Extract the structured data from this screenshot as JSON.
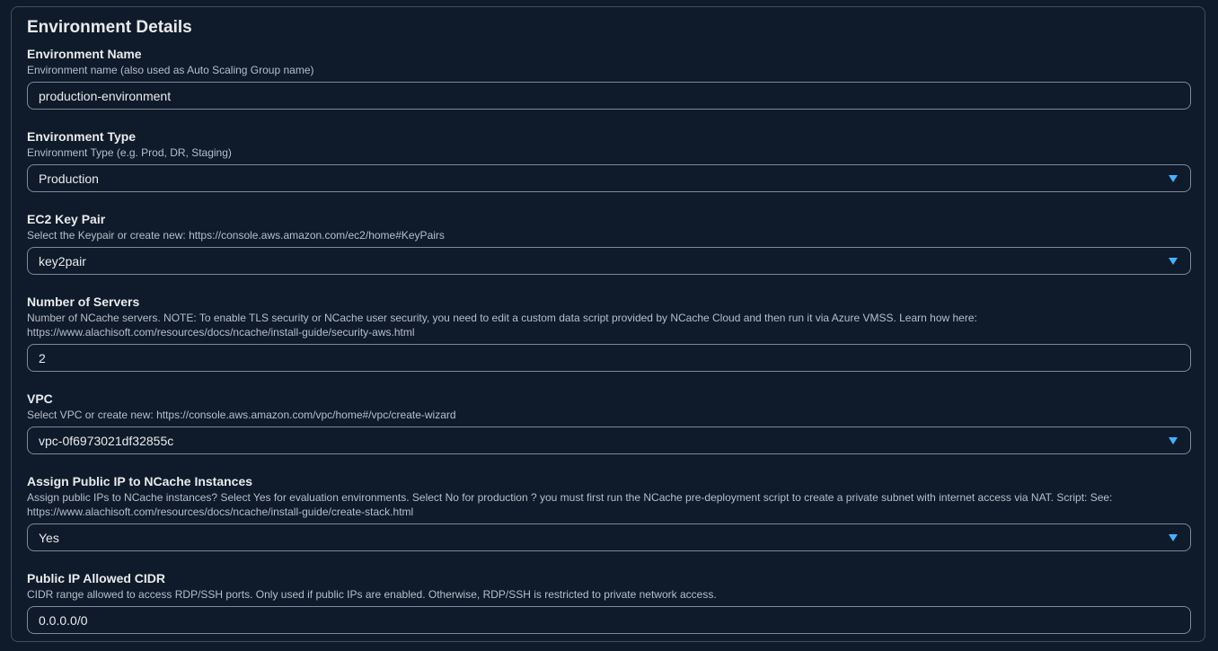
{
  "section": {
    "title": "Environment Details"
  },
  "fields": [
    {
      "label": "Environment Name",
      "description": "Environment name (also used as Auto Scaling Group name)",
      "value": "production-environment",
      "type": "input"
    },
    {
      "label": "Environment Type",
      "description": "Environment Type (e.g. Prod, DR, Staging)",
      "value": "Production",
      "type": "select"
    },
    {
      "label": "EC2 Key Pair",
      "description": "Select the Keypair or create new: https://console.aws.amazon.com/ec2/home#KeyPairs",
      "value": "key2pair",
      "type": "select"
    },
    {
      "label": "Number of Servers",
      "description": "Number of NCache servers. NOTE: To enable TLS security or NCache user security, you need to edit a custom data script provided by NCache Cloud and then run it via Azure VMSS. Learn how here: https://www.alachisoft.com/resources/docs/ncache/install-guide/security-aws.html",
      "value": "2",
      "type": "input"
    },
    {
      "label": "VPC",
      "description": "Select VPC or create new: https://console.aws.amazon.com/vpc/home#/vpc/create-wizard",
      "value": "vpc-0f6973021df32855c",
      "type": "select"
    },
    {
      "label": "Assign Public IP to NCache Instances",
      "description": "Assign public IPs to NCache instances? Select Yes for evaluation environments. Select No for production ? you must first run the NCache pre-deployment script to create a private subnet with internet access via NAT. Script: See: https://www.alachisoft.com/resources/docs/ncache/install-guide/create-stack.html",
      "value": "Yes",
      "type": "select"
    },
    {
      "label": "Public IP Allowed CIDR",
      "description": "CIDR range allowed to access RDP/SSH ports. Only used if public IPs are enabled. Otherwise, RDP/SSH is restricted to private network access.",
      "value": "0.0.0.0/0",
      "type": "input"
    }
  ],
  "icons": {
    "dropdown": "caret-down-icon"
  },
  "colors": {
    "background": "#0f1b2a",
    "accent": "#42b4ff",
    "border": "#7d8998"
  }
}
